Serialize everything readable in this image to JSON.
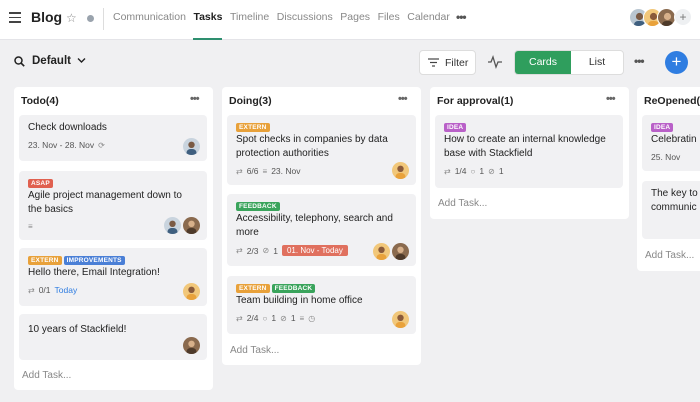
{
  "topbar": {
    "project_title": "Blog",
    "tabs": [
      "Communication",
      "Tasks",
      "Timeline",
      "Discussions",
      "Pages",
      "Files",
      "Calendar"
    ],
    "active_tab": "Tasks",
    "more": "•••",
    "add_member": "+"
  },
  "toolbar": {
    "view_name": "Default",
    "filter_label": "Filter",
    "cards_label": "Cards",
    "list_label": "List",
    "more": "•••",
    "add": "+"
  },
  "colors": {
    "accent_green": "#2f9e5d",
    "accent_blue": "#2f7de1",
    "tag_asap": "#e0604f",
    "tag_extern": "#e8a13a",
    "tag_improvements": "#4a7fd6",
    "tag_feedback": "#3aa45c",
    "tag_idea": "#b960c8",
    "due_overdue": "#e0705e"
  },
  "columns": [
    {
      "title": "Todo(4)",
      "more": "•••",
      "add_task": "Add Task...",
      "cards": [
        {
          "title": "Check downloads",
          "date": "23. Nov - 28. Nov"
        },
        {
          "tags": [
            "ASAP"
          ],
          "title": "Agile project management down to the basics"
        },
        {
          "tags": [
            "EXTERN",
            "IMPROVEMENTS"
          ],
          "title": "Hello there, Email Integration!",
          "subtasks": "0/1",
          "date": "Today"
        },
        {
          "title": "10 years of Stackfield!"
        }
      ]
    },
    {
      "title": "Doing(3)",
      "more": "•••",
      "add_task": "Add Task...",
      "cards": [
        {
          "tags": [
            "EXTERN"
          ],
          "title": "Spot checks in companies by data protection authorities",
          "subtasks": "6/6",
          "date": "23. Nov"
        },
        {
          "tags": [
            "FEEDBACK"
          ],
          "title": "Accessibility, telephony, search and more",
          "subtasks": "2/3",
          "attachments": "1",
          "due": "01. Nov - Today"
        },
        {
          "tags": [
            "EXTERN",
            "FEEDBACK"
          ],
          "title": "Team building in home office",
          "subtasks": "2/4",
          "comments": "1",
          "attachments": "1"
        }
      ]
    },
    {
      "title": "For approval(1)",
      "more": "•••",
      "add_task": "Add Task...",
      "cards": [
        {
          "tags": [
            "IDEA"
          ],
          "title": "How to create an internal knowledge base with Stackfield",
          "subtasks": "1/4",
          "comments": "1",
          "attachments": "1"
        }
      ]
    },
    {
      "title": "ReOpened(",
      "add_task": "Add Task...",
      "cards": [
        {
          "tags": [
            "IDEA"
          ],
          "title": "Celebratin",
          "date": "25. Nov"
        },
        {
          "title": "The key to communic"
        }
      ]
    }
  ]
}
